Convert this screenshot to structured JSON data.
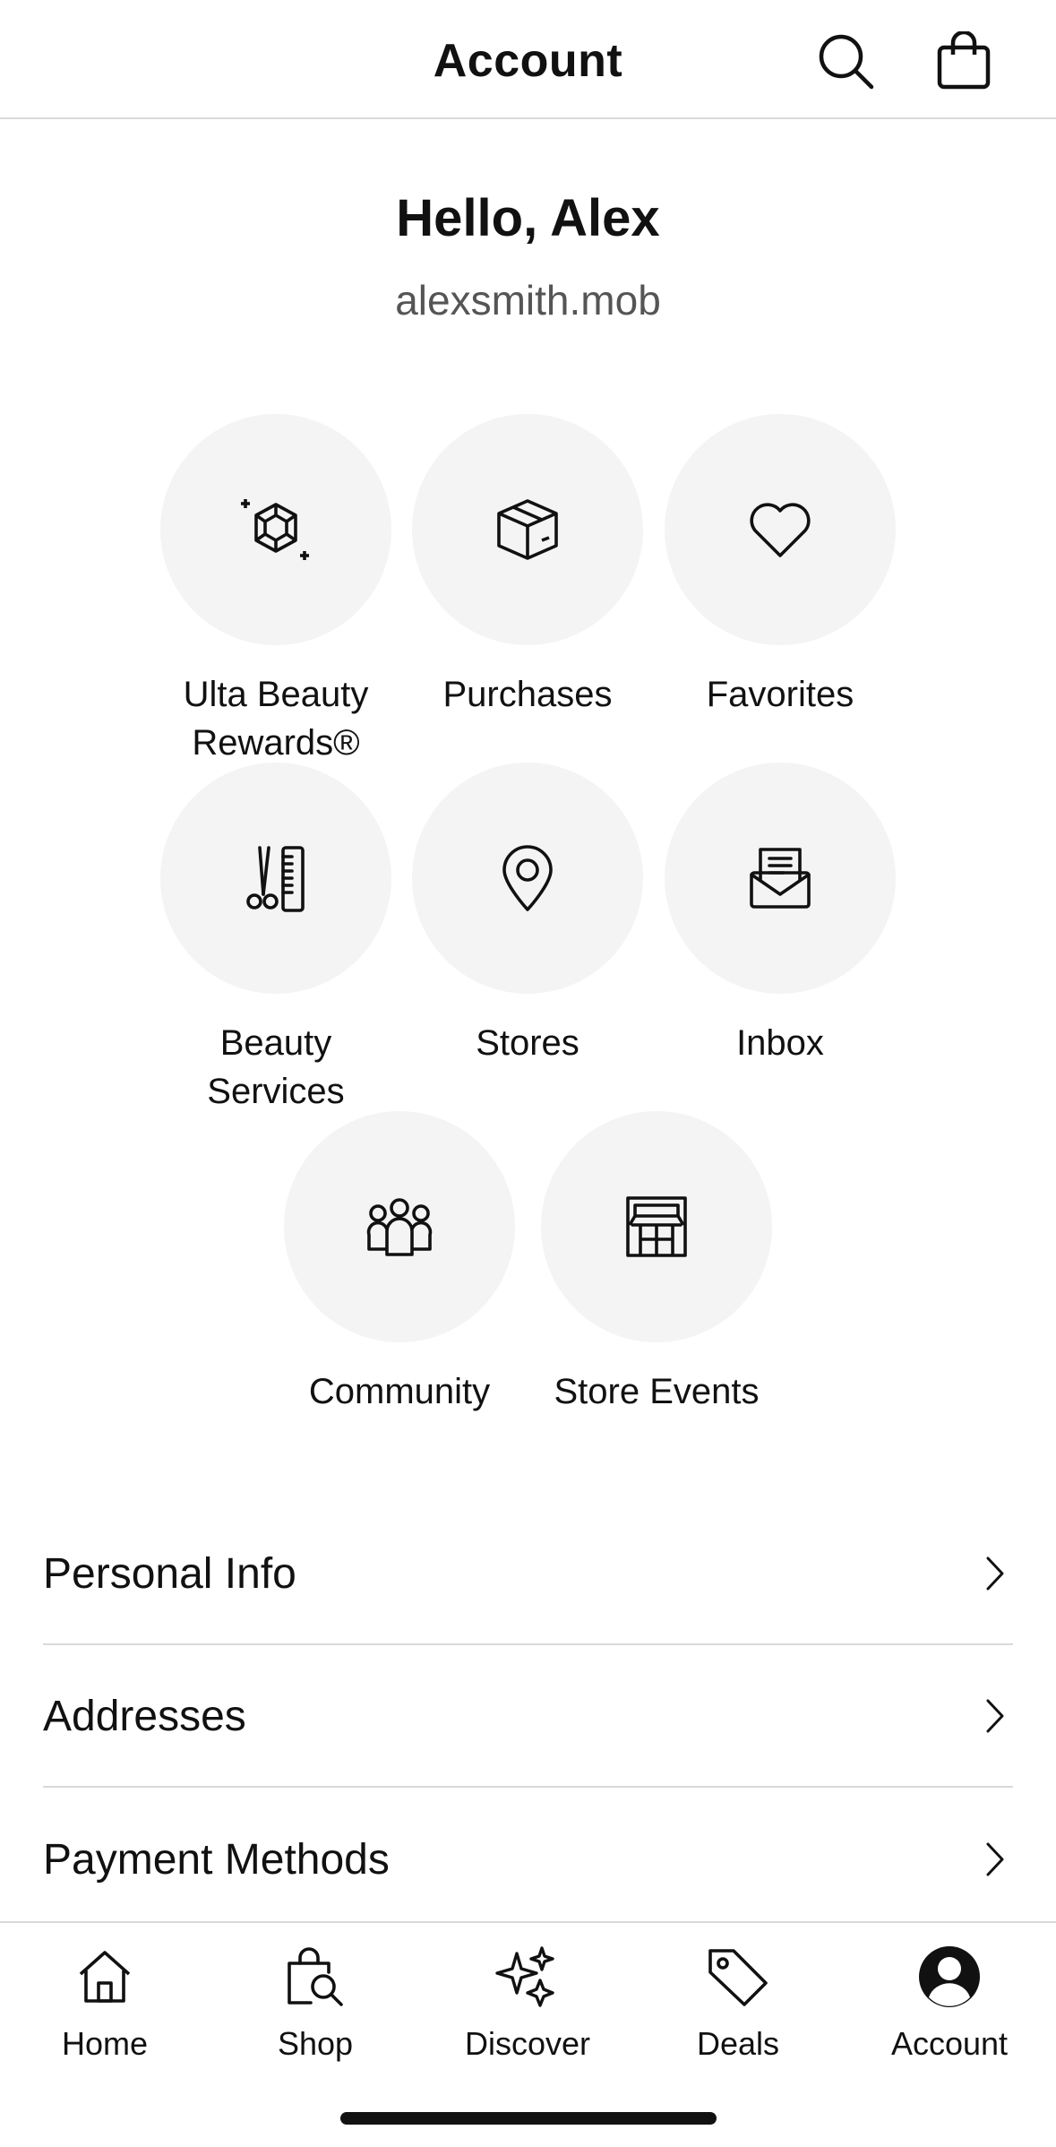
{
  "header": {
    "title": "Account"
  },
  "profile": {
    "greeting": "Hello, Alex",
    "username": "alexsmith.mob"
  },
  "tiles": [
    {
      "label": "Ulta Beauty Rewards®",
      "icon": "rewards-gem-icon"
    },
    {
      "label": "Purchases",
      "icon": "box-icon"
    },
    {
      "label": "Favorites",
      "icon": "heart-icon"
    },
    {
      "label": "Beauty Services",
      "icon": "scissors-comb-icon"
    },
    {
      "label": "Stores",
      "icon": "location-pin-icon"
    },
    {
      "label": "Inbox",
      "icon": "envelope-letter-icon"
    },
    {
      "label": "Community",
      "icon": "people-group-icon"
    },
    {
      "label": "Store Events",
      "icon": "storefront-icon"
    }
  ],
  "list": [
    {
      "label": "Personal Info"
    },
    {
      "label": "Addresses"
    },
    {
      "label": "Payment Methods"
    }
  ],
  "tabbar": [
    {
      "label": "Home",
      "icon": "home-icon"
    },
    {
      "label": "Shop",
      "icon": "shop-bag-search-icon"
    },
    {
      "label": "Discover",
      "icon": "sparkles-icon"
    },
    {
      "label": "Deals",
      "icon": "tag-icon"
    },
    {
      "label": "Account",
      "icon": "account-circle-icon",
      "active": true
    }
  ],
  "colors": {
    "tile_bg": "#f4f4f4",
    "divider": "#d9d9d9",
    "text": "#111111",
    "muted": "#555555"
  }
}
